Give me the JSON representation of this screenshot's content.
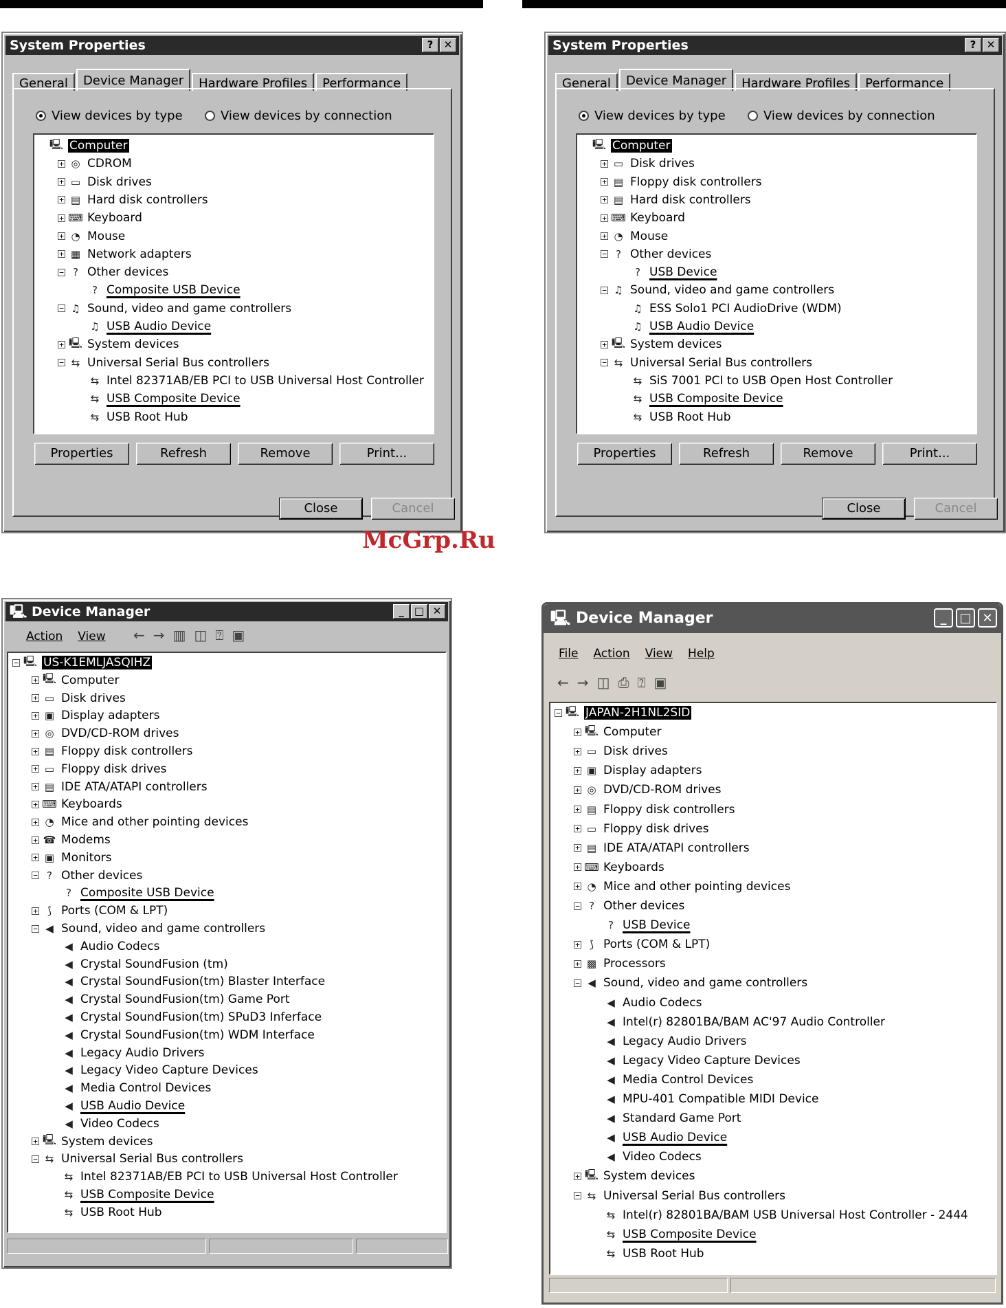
{
  "watermark": "McGrp.Ru",
  "sp1": {
    "title": "System Properties",
    "help_btn": "?",
    "close_btn": "✕",
    "tabs": [
      "General",
      "Device Manager",
      "Hardware Profiles",
      "Performance"
    ],
    "radio_type": "View devices by type",
    "radio_connection": "View devices by connection",
    "tree": [
      {
        "label": "Computer",
        "indent": 0,
        "exp": "",
        "icon": "computer-icon",
        "sel": true
      },
      {
        "label": "CDROM",
        "indent": 1,
        "exp": "+",
        "icon": "cdrom-icon"
      },
      {
        "label": "Disk drives",
        "indent": 1,
        "exp": "+",
        "icon": "disk-icon"
      },
      {
        "label": "Hard disk controllers",
        "indent": 1,
        "exp": "+",
        "icon": "controller-icon"
      },
      {
        "label": "Keyboard",
        "indent": 1,
        "exp": "+",
        "icon": "keyboard-icon"
      },
      {
        "label": "Mouse",
        "indent": 1,
        "exp": "+",
        "icon": "mouse-icon"
      },
      {
        "label": "Network adapters",
        "indent": 1,
        "exp": "+",
        "icon": "network-icon"
      },
      {
        "label": "Other devices",
        "indent": 1,
        "exp": "−",
        "icon": "question-icon"
      },
      {
        "label": "Composite USB Device",
        "indent": 2,
        "exp": "",
        "icon": "question-icon",
        "ul": true
      },
      {
        "label": "Sound, video and game controllers",
        "indent": 1,
        "exp": "−",
        "icon": "sound-icon"
      },
      {
        "label": "USB Audio Device",
        "indent": 2,
        "exp": "",
        "icon": "sound-icon",
        "ul": true
      },
      {
        "label": "System devices",
        "indent": 1,
        "exp": "+",
        "icon": "computer-icon"
      },
      {
        "label": "Universal Serial Bus controllers",
        "indent": 1,
        "exp": "−",
        "icon": "usb-icon"
      },
      {
        "label": "Intel 82371AB/EB PCI to USB Universal Host Controller",
        "indent": 2,
        "exp": "",
        "icon": "usb-icon"
      },
      {
        "label": "USB Composite Device",
        "indent": 2,
        "exp": "",
        "icon": "usb-icon",
        "ul": true
      },
      {
        "label": "USB Root Hub",
        "indent": 2,
        "exp": "",
        "icon": "usb-icon"
      }
    ],
    "buttons": [
      "Properties",
      "Refresh",
      "Remove",
      "Print..."
    ],
    "close_label": "Close",
    "cancel_label": "Cancel"
  },
  "sp2": {
    "title": "System Properties",
    "help_btn": "?",
    "close_btn": "✕",
    "tabs": [
      "General",
      "Device Manager",
      "Hardware Profiles",
      "Performance"
    ],
    "radio_type": "View devices by type",
    "radio_connection": "View devices by connection",
    "tree": [
      {
        "label": "Computer",
        "indent": 0,
        "exp": "",
        "icon": "computer-icon",
        "sel": true
      },
      {
        "label": "Disk drives",
        "indent": 1,
        "exp": "+",
        "icon": "disk-icon"
      },
      {
        "label": "Floppy disk controllers",
        "indent": 1,
        "exp": "+",
        "icon": "controller-icon"
      },
      {
        "label": "Hard disk controllers",
        "indent": 1,
        "exp": "+",
        "icon": "controller-icon"
      },
      {
        "label": "Keyboard",
        "indent": 1,
        "exp": "+",
        "icon": "keyboard-icon"
      },
      {
        "label": "Mouse",
        "indent": 1,
        "exp": "+",
        "icon": "mouse-icon"
      },
      {
        "label": "Other devices",
        "indent": 1,
        "exp": "−",
        "icon": "question-icon"
      },
      {
        "label": "USB Device",
        "indent": 2,
        "exp": "",
        "icon": "question-icon",
        "ul": true
      },
      {
        "label": "Sound, video and game controllers",
        "indent": 1,
        "exp": "−",
        "icon": "sound-icon"
      },
      {
        "label": "ESS Solo1 PCI AudioDrive (WDM)",
        "indent": 2,
        "exp": "",
        "icon": "sound-icon"
      },
      {
        "label": "USB Audio Device",
        "indent": 2,
        "exp": "",
        "icon": "sound-icon",
        "ul": true
      },
      {
        "label": "System devices",
        "indent": 1,
        "exp": "+",
        "icon": "computer-icon"
      },
      {
        "label": "Universal Serial Bus controllers",
        "indent": 1,
        "exp": "−",
        "icon": "usb-icon"
      },
      {
        "label": "SiS 7001 PCI to USB Open Host Controller",
        "indent": 2,
        "exp": "",
        "icon": "usb-icon"
      },
      {
        "label": "USB Composite Device",
        "indent": 2,
        "exp": "",
        "icon": "usb-icon",
        "ul": true
      },
      {
        "label": "USB Root Hub",
        "indent": 2,
        "exp": "",
        "icon": "usb-icon"
      }
    ],
    "buttons": [
      "Properties",
      "Refresh",
      "Remove",
      "Print..."
    ],
    "close_label": "Close",
    "cancel_label": "Cancel"
  },
  "dm1": {
    "title": "Device Manager",
    "menu": [
      "Action",
      "View"
    ],
    "tree": [
      {
        "label": "US-K1EMLJASQIHZ",
        "indent": 0,
        "exp": "−",
        "icon": "computer-icon",
        "sel": true
      },
      {
        "label": "Computer",
        "indent": 1,
        "exp": "+",
        "icon": "computer-icon"
      },
      {
        "label": "Disk drives",
        "indent": 1,
        "exp": "+",
        "icon": "disk-icon"
      },
      {
        "label": "Display adapters",
        "indent": 1,
        "exp": "+",
        "icon": "monitor-icon"
      },
      {
        "label": "DVD/CD-ROM drives",
        "indent": 1,
        "exp": "+",
        "icon": "cdrom-icon"
      },
      {
        "label": "Floppy disk controllers",
        "indent": 1,
        "exp": "+",
        "icon": "controller-icon"
      },
      {
        "label": "Floppy disk drives",
        "indent": 1,
        "exp": "+",
        "icon": "disk-icon"
      },
      {
        "label": "IDE ATA/ATAPI controllers",
        "indent": 1,
        "exp": "+",
        "icon": "controller-icon"
      },
      {
        "label": "Keyboards",
        "indent": 1,
        "exp": "+",
        "icon": "keyboard-icon"
      },
      {
        "label": "Mice and other pointing devices",
        "indent": 1,
        "exp": "+",
        "icon": "mouse-icon"
      },
      {
        "label": "Modems",
        "indent": 1,
        "exp": "+",
        "icon": "modem-icon"
      },
      {
        "label": "Monitors",
        "indent": 1,
        "exp": "+",
        "icon": "monitor-icon"
      },
      {
        "label": "Other devices",
        "indent": 1,
        "exp": "−",
        "icon": "question-icon"
      },
      {
        "label": "Composite USB Device",
        "indent": 2,
        "exp": "",
        "icon": "question-icon",
        "ul": true
      },
      {
        "label": "Ports (COM & LPT)",
        "indent": 1,
        "exp": "+",
        "icon": "port-icon"
      },
      {
        "label": "Sound, video and game controllers",
        "indent": 1,
        "exp": "−",
        "icon": "speaker-icon"
      },
      {
        "label": "Audio Codecs",
        "indent": 2,
        "exp": "",
        "icon": "speaker-icon"
      },
      {
        "label": "Crystal SoundFusion (tm)",
        "indent": 2,
        "exp": "",
        "icon": "speaker-icon"
      },
      {
        "label": "Crystal SoundFusion(tm) Blaster Interface",
        "indent": 2,
        "exp": "",
        "icon": "speaker-icon"
      },
      {
        "label": "Crystal SoundFusion(tm) Game Port",
        "indent": 2,
        "exp": "",
        "icon": "speaker-icon"
      },
      {
        "label": "Crystal SoundFusion(tm) SPuD3 Inferface",
        "indent": 2,
        "exp": "",
        "icon": "speaker-icon"
      },
      {
        "label": "Crystal SoundFusion(tm) WDM Interface",
        "indent": 2,
        "exp": "",
        "icon": "speaker-icon"
      },
      {
        "label": "Legacy Audio Drivers",
        "indent": 2,
        "exp": "",
        "icon": "speaker-icon"
      },
      {
        "label": "Legacy Video Capture Devices",
        "indent": 2,
        "exp": "",
        "icon": "speaker-icon"
      },
      {
        "label": "Media Control Devices",
        "indent": 2,
        "exp": "",
        "icon": "speaker-icon"
      },
      {
        "label": "USB Audio Device",
        "indent": 2,
        "exp": "",
        "icon": "speaker-icon",
        "ul": true
      },
      {
        "label": "Video Codecs",
        "indent": 2,
        "exp": "",
        "icon": "speaker-icon"
      },
      {
        "label": "System devices",
        "indent": 1,
        "exp": "+",
        "icon": "computer-icon"
      },
      {
        "label": "Universal Serial Bus controllers",
        "indent": 1,
        "exp": "−",
        "icon": "usb-icon"
      },
      {
        "label": "Intel 82371AB/EB PCI to USB Universal Host Controller",
        "indent": 2,
        "exp": "",
        "icon": "usb-icon"
      },
      {
        "label": "USB Composite Device",
        "indent": 2,
        "exp": "",
        "icon": "usb-icon",
        "ul": true
      },
      {
        "label": "USB Root Hub",
        "indent": 2,
        "exp": "",
        "icon": "usb-icon"
      }
    ]
  },
  "dm2": {
    "title": "Device Manager",
    "menu": [
      "File",
      "Action",
      "View",
      "Help"
    ],
    "tree": [
      {
        "label": "JAPAN-2H1NL2SID",
        "indent": 0,
        "exp": "−",
        "icon": "computer-icon",
        "sel": true
      },
      {
        "label": "Computer",
        "indent": 1,
        "exp": "+",
        "icon": "computer-icon"
      },
      {
        "label": "Disk drives",
        "indent": 1,
        "exp": "+",
        "icon": "disk-icon"
      },
      {
        "label": "Display adapters",
        "indent": 1,
        "exp": "+",
        "icon": "monitor-icon"
      },
      {
        "label": "DVD/CD-ROM drives",
        "indent": 1,
        "exp": "+",
        "icon": "cdrom-icon"
      },
      {
        "label": "Floppy disk controllers",
        "indent": 1,
        "exp": "+",
        "icon": "controller-icon"
      },
      {
        "label": "Floppy disk drives",
        "indent": 1,
        "exp": "+",
        "icon": "disk-icon"
      },
      {
        "label": "IDE ATA/ATAPI controllers",
        "indent": 1,
        "exp": "+",
        "icon": "controller-icon"
      },
      {
        "label": "Keyboards",
        "indent": 1,
        "exp": "+",
        "icon": "keyboard-icon"
      },
      {
        "label": "Mice and other pointing devices",
        "indent": 1,
        "exp": "+",
        "icon": "mouse-icon"
      },
      {
        "label": "Other devices",
        "indent": 1,
        "exp": "−",
        "icon": "question-icon"
      },
      {
        "label": "USB Device",
        "indent": 2,
        "exp": "",
        "icon": "question-icon",
        "ul": true
      },
      {
        "label": "Ports (COM & LPT)",
        "indent": 1,
        "exp": "+",
        "icon": "port-icon"
      },
      {
        "label": "Processors",
        "indent": 1,
        "exp": "+",
        "icon": "chip-icon"
      },
      {
        "label": "Sound, video and game controllers",
        "indent": 1,
        "exp": "−",
        "icon": "speaker-icon"
      },
      {
        "label": "Audio Codecs",
        "indent": 2,
        "exp": "",
        "icon": "speaker-icon"
      },
      {
        "label": "Intel(r) 82801BA/BAM AC'97 Audio Controller",
        "indent": 2,
        "exp": "",
        "icon": "speaker-icon"
      },
      {
        "label": "Legacy Audio Drivers",
        "indent": 2,
        "exp": "",
        "icon": "speaker-icon"
      },
      {
        "label": "Legacy Video Capture Devices",
        "indent": 2,
        "exp": "",
        "icon": "speaker-icon"
      },
      {
        "label": "Media Control Devices",
        "indent": 2,
        "exp": "",
        "icon": "speaker-icon"
      },
      {
        "label": "MPU-401 Compatible MIDI Device",
        "indent": 2,
        "exp": "",
        "icon": "speaker-icon"
      },
      {
        "label": "Standard Game Port",
        "indent": 2,
        "exp": "",
        "icon": "speaker-icon"
      },
      {
        "label": "USB Audio Device",
        "indent": 2,
        "exp": "",
        "icon": "speaker-icon",
        "ul": true
      },
      {
        "label": "Video Codecs",
        "indent": 2,
        "exp": "",
        "icon": "speaker-icon"
      },
      {
        "label": "System devices",
        "indent": 1,
        "exp": "+",
        "icon": "computer-icon"
      },
      {
        "label": "Universal Serial Bus controllers",
        "indent": 1,
        "exp": "−",
        "icon": "usb-icon"
      },
      {
        "label": "Intel(r) 82801BA/BAM USB Universal Host Controller - 2444",
        "indent": 2,
        "exp": "",
        "icon": "usb-icon"
      },
      {
        "label": "USB Composite Device",
        "indent": 2,
        "exp": "",
        "icon": "usb-icon",
        "ul": true
      },
      {
        "label": "USB Root Hub",
        "indent": 2,
        "exp": "",
        "icon": "usb-icon"
      }
    ]
  },
  "icons": {
    "computer-icon": "🖳",
    "cdrom-icon": "◎",
    "disk-icon": "▭",
    "controller-icon": "▤",
    "keyboard-icon": "⌨",
    "mouse-icon": "◔",
    "network-icon": "▦",
    "question-icon": "?",
    "sound-icon": "♫",
    "usb-icon": "⇆",
    "monitor-icon": "▣",
    "modem-icon": "☎",
    "port-icon": "⟆",
    "speaker-icon": "◀",
    "chip-icon": "▩"
  }
}
